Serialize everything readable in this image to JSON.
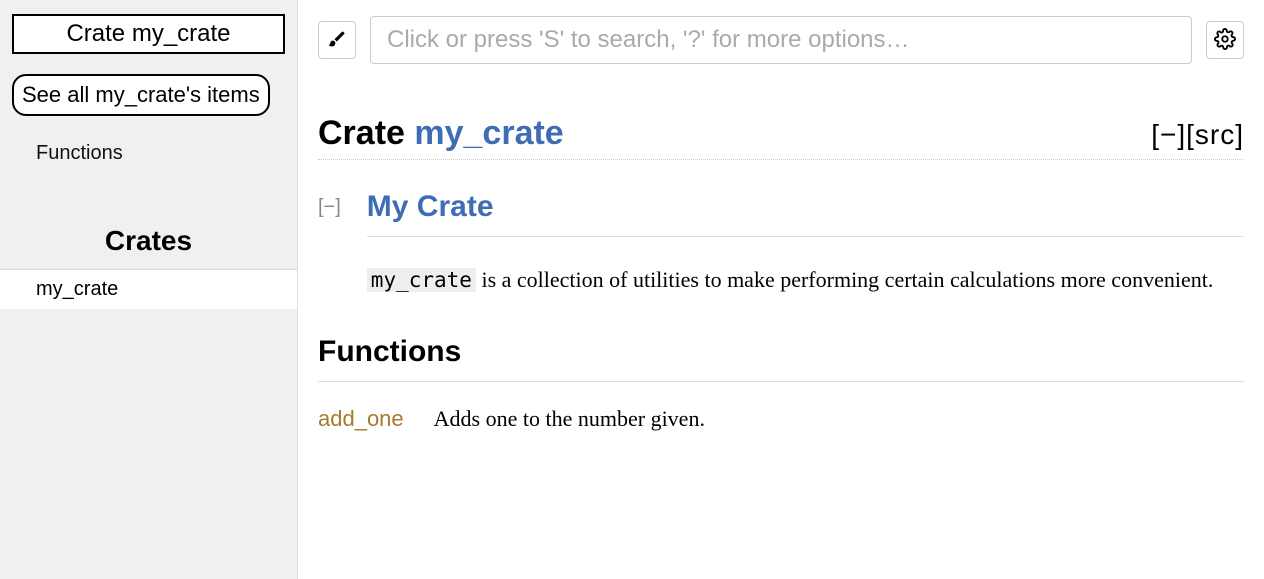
{
  "sidebar": {
    "title": "Crate my_crate",
    "see_all": "See all my_crate's items",
    "links": [
      "Functions"
    ],
    "crates_heading": "Crates",
    "crates": [
      "my_crate"
    ]
  },
  "search": {
    "placeholder": "Click or press 'S' to search, '?' for more options…"
  },
  "heading": {
    "prefix": "Crate ",
    "name": "my_crate",
    "collapse": "[−]",
    "src": "[src]"
  },
  "doc": {
    "collapse": "[−]",
    "title": "My Crate",
    "code": "my_crate",
    "rest": " is a collection of utilities to make performing certain calculations more convenient."
  },
  "functions": {
    "heading": "Functions",
    "items": [
      {
        "name": "add_one",
        "desc": "Adds one to the number given."
      }
    ]
  }
}
